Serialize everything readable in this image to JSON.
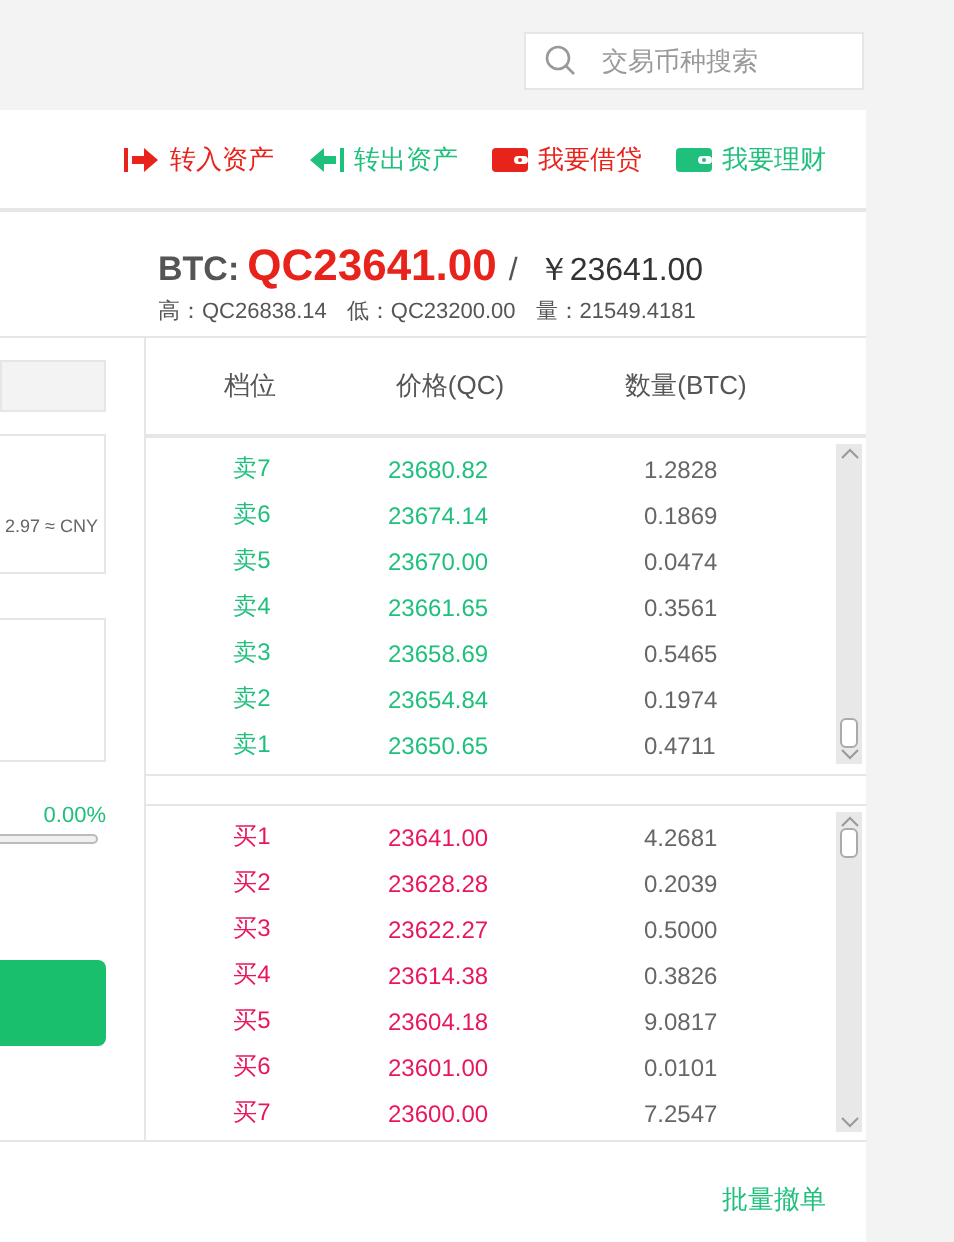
{
  "search": {
    "placeholder": "交易币种搜索"
  },
  "actions": [
    {
      "kind": "in",
      "label": "转入资产",
      "color": "#e8231b"
    },
    {
      "kind": "out",
      "label": "转出资产",
      "color": "#1fbf7c"
    },
    {
      "kind": "loan",
      "label": "我要借贷",
      "color": "#e8231b"
    },
    {
      "kind": "finance",
      "label": "我要理财",
      "color": "#1fbf7c"
    }
  ],
  "ticker": {
    "symbol": "BTC:",
    "price": "QC23641.00",
    "separator": "/",
    "cny": "￥23641.00",
    "stats": [
      {
        "label": "高：",
        "value": "QC26838.14"
      },
      {
        "label": "低：",
        "value": "QC23200.00"
      },
      {
        "label": "量：",
        "value": "21549.4181"
      }
    ]
  },
  "trade_panel": {
    "cny_hint": "2.97 ≈ CNY",
    "percent": "0.00%",
    "slider": {
      "level": 0
    }
  },
  "orderbook": {
    "columns": [
      "档位",
      "价格(QC)",
      "数量(BTC)"
    ],
    "asks": [
      {
        "tier": "卖7",
        "price": "23680.82",
        "amount": "1.2828"
      },
      {
        "tier": "卖6",
        "price": "23674.14",
        "amount": "0.1869"
      },
      {
        "tier": "卖5",
        "price": "23670.00",
        "amount": "0.0474"
      },
      {
        "tier": "卖4",
        "price": "23661.65",
        "amount": "0.3561"
      },
      {
        "tier": "卖3",
        "price": "23658.69",
        "amount": "0.5465"
      },
      {
        "tier": "卖2",
        "price": "23654.84",
        "amount": "0.1974"
      },
      {
        "tier": "卖1",
        "price": "23650.65",
        "amount": "0.4711"
      }
    ],
    "bids": [
      {
        "tier": "买1",
        "price": "23641.00",
        "amount": "4.2681"
      },
      {
        "tier": "买2",
        "price": "23628.28",
        "amount": "0.2039"
      },
      {
        "tier": "买3",
        "price": "23622.27",
        "amount": "0.5000"
      },
      {
        "tier": "买4",
        "price": "23614.38",
        "amount": "0.3826"
      },
      {
        "tier": "买5",
        "price": "23604.18",
        "amount": "9.0817"
      },
      {
        "tier": "买6",
        "price": "23601.00",
        "amount": "0.0101"
      },
      {
        "tier": "买7",
        "price": "23600.00",
        "amount": "7.2547"
      }
    ]
  },
  "batch_cancel": "批量撤单"
}
